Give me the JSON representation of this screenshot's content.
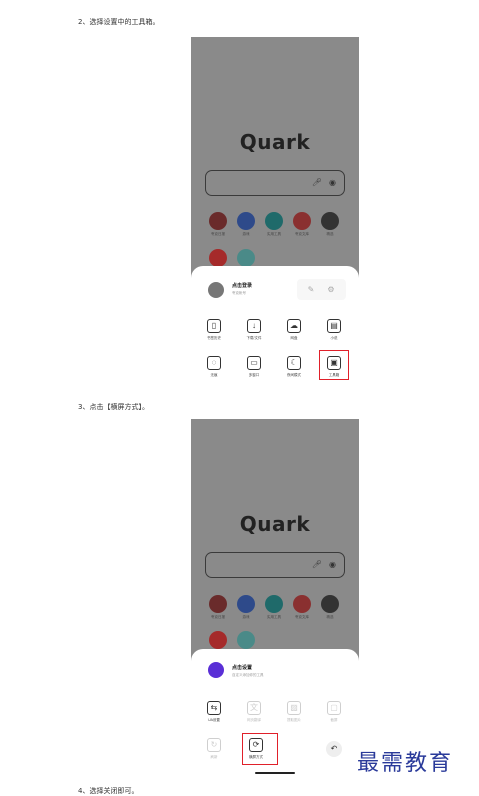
{
  "steps": {
    "s2": "2、选择设置中的工具箱。",
    "s3": "3、点击【横屏方式】。",
    "s4": "4、选择关闭即可。"
  },
  "shot1": {
    "logo": "Quark",
    "apps": [
      {
        "label": "夸克日报",
        "color": "#6a2b2b"
      },
      {
        "label": "游戏",
        "color": "#2e4a8a"
      },
      {
        "label": "实用工具",
        "color": "#1f6a6a"
      },
      {
        "label": "夸克文库",
        "color": "#8a3030"
      },
      {
        "label": "精选",
        "color": "#333333"
      }
    ],
    "login_title": "点击登录",
    "login_sub": "夸克帐号",
    "tools": [
      {
        "label": "书签历史",
        "icon": "bookmark-icon",
        "glyph": "▯"
      },
      {
        "label": "下载/文件",
        "icon": "download-icon",
        "glyph": "↓"
      },
      {
        "label": "网盘",
        "icon": "cloud-icon",
        "glyph": "☁"
      },
      {
        "label": "小说",
        "icon": "book-icon",
        "glyph": "▤"
      },
      {
        "label": "无痕",
        "icon": "ghost-icon",
        "glyph": "◌"
      },
      {
        "label": "多窗口",
        "icon": "window-icon",
        "glyph": "▭"
      },
      {
        "label": "夜间模式",
        "icon": "moon-icon",
        "glyph": "☾"
      },
      {
        "label": "工具箱",
        "icon": "toolbox-icon",
        "glyph": "▣"
      }
    ]
  },
  "shot2": {
    "logo": "Quark",
    "apps": [
      {
        "label": "夸克日报",
        "color": "#6a2b2b"
      },
      {
        "label": "游戏",
        "color": "#2e4a8a"
      },
      {
        "label": "实用工具",
        "color": "#1f6a6a"
      },
      {
        "label": "夸克文库",
        "color": "#8a3030"
      },
      {
        "label": "精选",
        "color": "#333333"
      }
    ],
    "login_title": "点击设置",
    "login_sub": "自定义添加你的工具",
    "tools_row1": [
      {
        "label": "UA设置",
        "icon": "ua-icon",
        "glyph": "⇆",
        "dim": false
      },
      {
        "label": "网页翻译",
        "icon": "translate-icon",
        "glyph": "文",
        "dim": true
      },
      {
        "label": "提取图片",
        "icon": "image-icon",
        "glyph": "▨",
        "dim": true
      },
      {
        "label": "截屏",
        "icon": "screenshot-icon",
        "glyph": "▢",
        "dim": true
      }
    ],
    "tools_row2": [
      {
        "label": "刷新",
        "icon": "refresh-icon",
        "glyph": "↻",
        "dim": true
      },
      {
        "label": "横屏方式",
        "icon": "rotate-icon",
        "glyph": "⟳",
        "dim": false
      }
    ]
  },
  "watermark": "最需教育"
}
